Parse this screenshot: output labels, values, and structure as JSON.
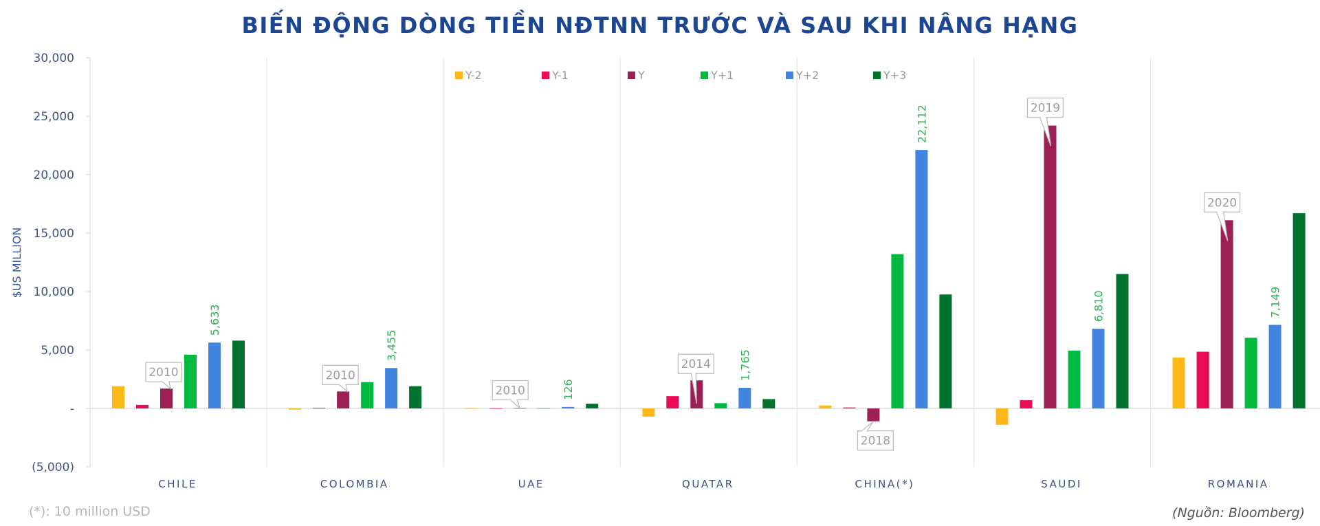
{
  "chart_data": {
    "type": "bar",
    "title": "BIẾN ĐỘNG DÒNG TIỀN NĐTNN TRƯỚC VÀ SAU KHI NÂNG HẠNG",
    "xlabel": "",
    "ylabel": "$US MILLION",
    "ylim": [
      -5000,
      30000
    ],
    "yticks": [
      30000,
      25000,
      20000,
      15000,
      10000,
      5000,
      0,
      -5000
    ],
    "ytick_labels": [
      "30,000",
      "25,000",
      "20,000",
      "15,000",
      "10,000",
      "5,000",
      "-",
      "(5,000)"
    ],
    "grid": "vertical group dividers",
    "legend_position": "top",
    "categories": [
      "CHILE",
      "COLOMBIA",
      "UAE",
      "QUATAR",
      "CHINA(*)",
      "SAUDI",
      "ROMANIA"
    ],
    "series": [
      {
        "name": "Y-2",
        "color": "#ffb81c",
        "values": [
          1900,
          -100,
          0,
          -700,
          250,
          -1400,
          4350
        ]
      },
      {
        "name": "Y-1",
        "color": "#ea0b57",
        "values": [
          300,
          50,
          0,
          1050,
          80,
          700,
          4850
        ]
      },
      {
        "name": "Y",
        "color": "#9c1f55",
        "values": [
          1700,
          1450,
          30,
          2400,
          -1100,
          24200,
          16100
        ]
      },
      {
        "name": "Y+1",
        "color": "#00b941",
        "values": [
          4600,
          2250,
          20,
          450,
          13200,
          4950,
          6050
        ]
      },
      {
        "name": "Y+2",
        "color": "#4285e0",
        "values": [
          5633,
          3455,
          126,
          1765,
          22112,
          6810,
          7149
        ]
      },
      {
        "name": "Y+3",
        "color": "#00722b",
        "values": [
          5800,
          1900,
          400,
          800,
          9750,
          11500,
          16700
        ]
      }
    ],
    "data_labels": [
      {
        "category": "CHILE",
        "series": "Y+2",
        "text": "5,633"
      },
      {
        "category": "COLOMBIA",
        "series": "Y+2",
        "text": "3,455"
      },
      {
        "category": "UAE",
        "series": "Y+2",
        "text": "126"
      },
      {
        "category": "QUATAR",
        "series": "Y+2",
        "text": "1,765"
      },
      {
        "category": "CHINA(*)",
        "series": "Y+2",
        "text": "22,112"
      },
      {
        "category": "SAUDI",
        "series": "Y+2",
        "text": "6,810"
      },
      {
        "category": "ROMANIA",
        "series": "Y+2",
        "text": "7,149"
      }
    ],
    "annotations": [
      {
        "category": "CHILE",
        "series": "Y",
        "text": "2010"
      },
      {
        "category": "COLOMBIA",
        "series": "Y",
        "text": "2010"
      },
      {
        "category": "UAE",
        "series": "Y",
        "text": "2010"
      },
      {
        "category": "QUATAR",
        "series": "Y",
        "text": "2014"
      },
      {
        "category": "CHINA(*)",
        "series": "Y",
        "text": "2018"
      },
      {
        "category": "SAUDI",
        "series": "Y",
        "text": "2019"
      },
      {
        "category": "ROMANIA",
        "series": "Y",
        "text": "2020"
      }
    ]
  },
  "footnote": "(*): 10 million USD",
  "source": "(Nguồn:  Bloomberg)"
}
